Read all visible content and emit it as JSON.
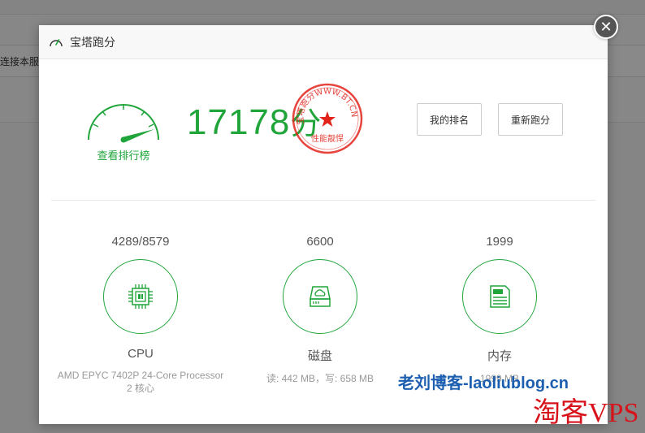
{
  "background": {
    "partial_text": "连接本服"
  },
  "dialog": {
    "title": "宝塔跑分",
    "close_icon": "close-icon"
  },
  "score": {
    "value": "17178",
    "unit": "分",
    "leaderboard_link": "查看排行榜"
  },
  "stamp": {
    "text": "宝塔跑分WWW.BT.CN",
    "bottom": "性能靓悍"
  },
  "buttons": {
    "rank": "我的排名",
    "rerun": "重新跑分"
  },
  "metrics": {
    "cpu": {
      "value": "4289/8579",
      "label": "CPU",
      "desc": "AMD EPYC 7402P 24-Core Processor 2 核心",
      "icon": "cpu-chip-icon"
    },
    "disk": {
      "value": "6600",
      "label": "磁盘",
      "desc": "读: 442 MB，写: 658 MB",
      "icon": "disk-drive-icon"
    },
    "mem": {
      "value": "1999",
      "label": "内存",
      "desc": "1999 MB",
      "icon": "memory-icon"
    }
  },
  "watermarks": {
    "blog": "老刘博客-laoliublog.cn",
    "vps": "淘客VPS"
  },
  "colors": {
    "accent": "#20a53a",
    "stamp": "#e2231a"
  }
}
